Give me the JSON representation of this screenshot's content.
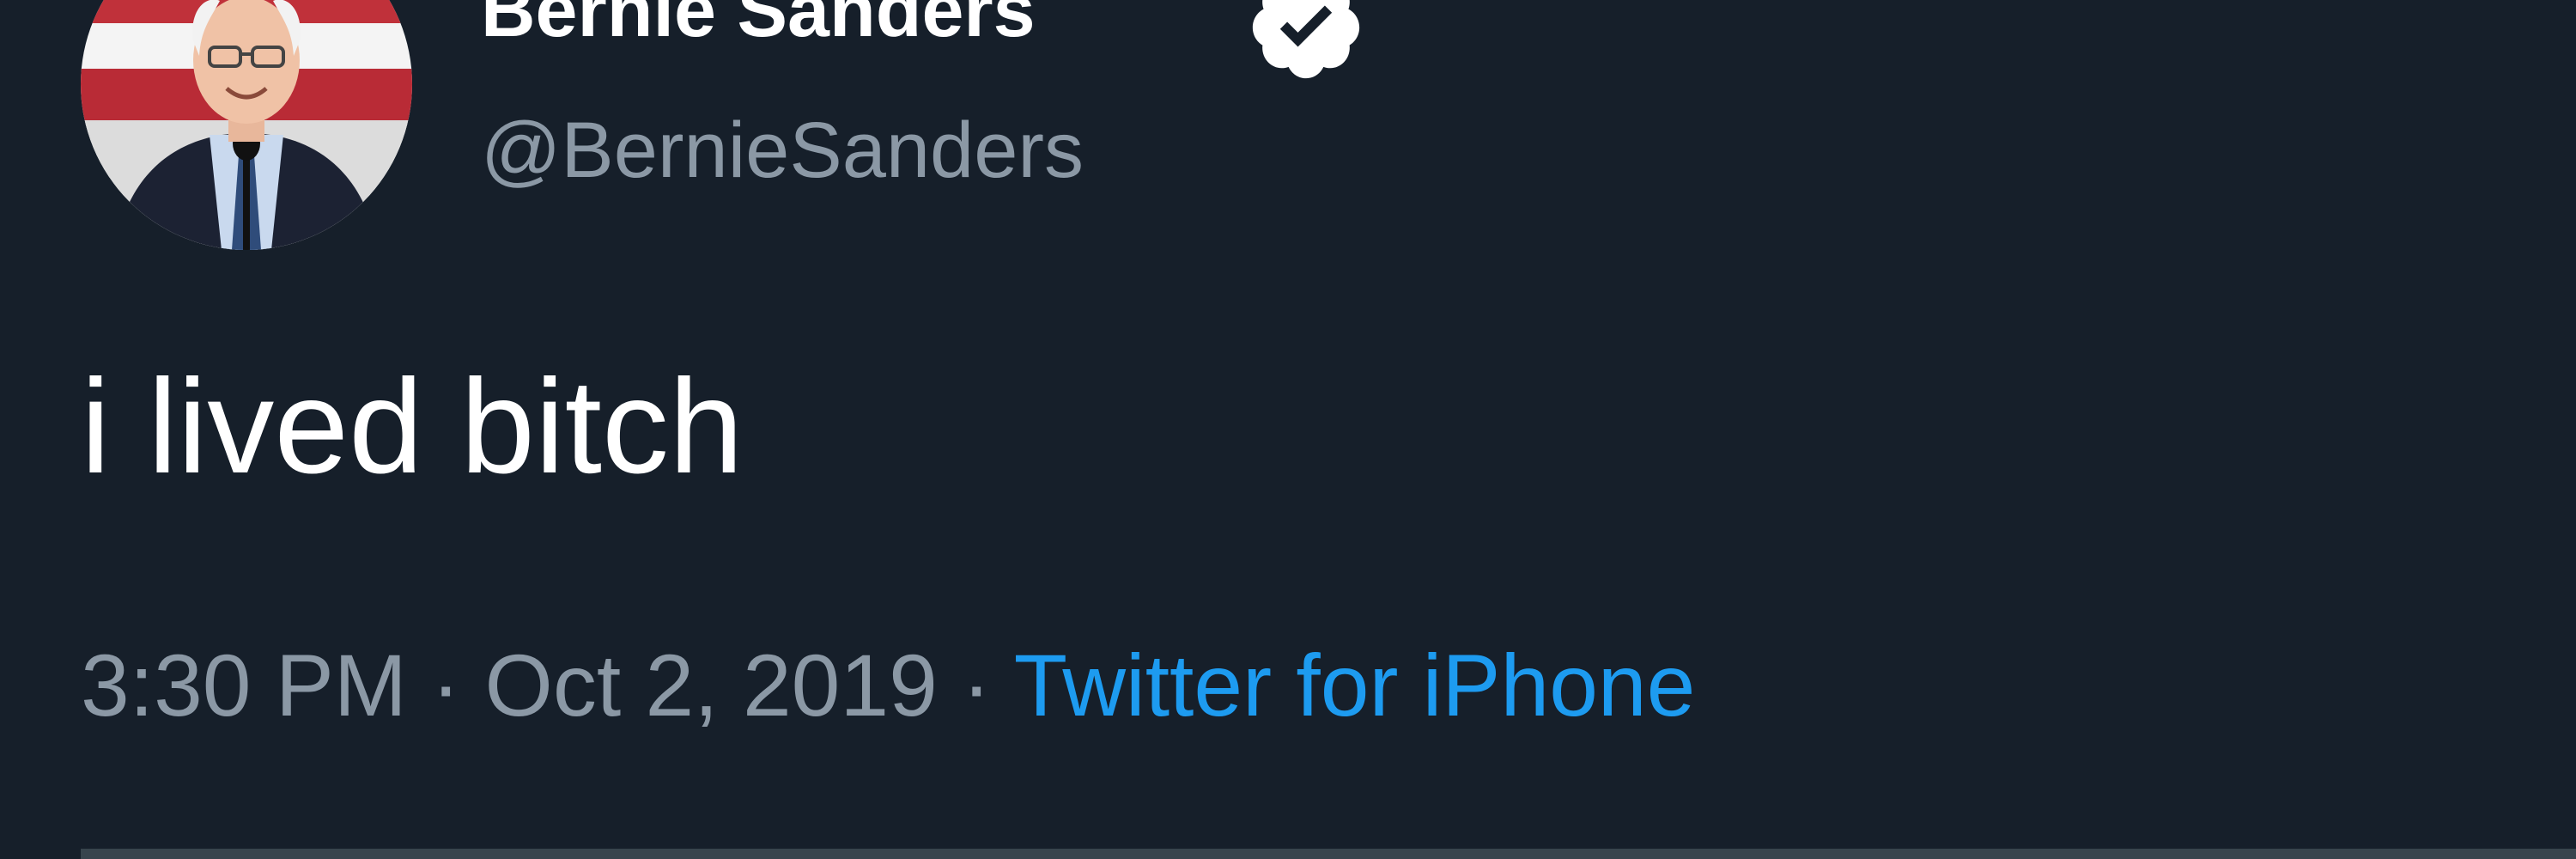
{
  "tweet": {
    "author": {
      "display_name": "Bernie Sanders",
      "handle": "@BernieSanders",
      "verified": true,
      "avatar_icon": "profile-photo"
    },
    "text": "i lived bitch",
    "time": "3:30 PM",
    "separator": " · ",
    "date": "Oct 2, 2019",
    "source": "Twitter for iPhone"
  },
  "colors": {
    "background": "#161f2a",
    "primary_text": "#ffffff",
    "secondary_text": "#8b98a5",
    "link": "#1d9bf0",
    "divider": "#38444d"
  }
}
